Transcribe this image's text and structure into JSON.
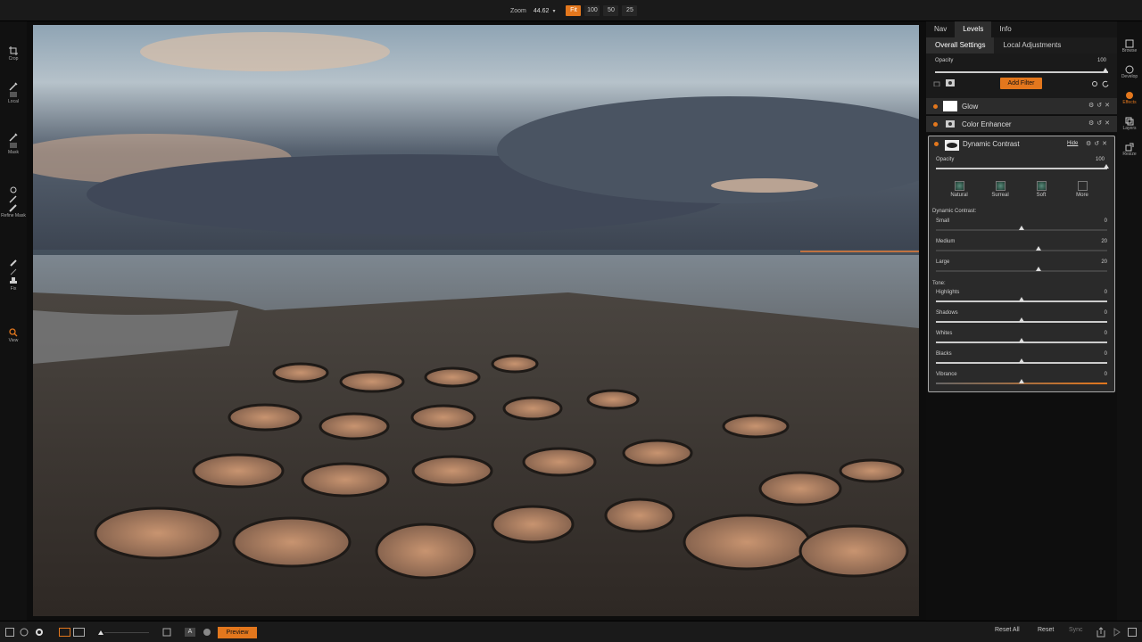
{
  "zoom": {
    "label": "Zoom",
    "value": "44.62",
    "buttons": [
      "Fit",
      "100",
      "50",
      "25"
    ],
    "active": "Fit"
  },
  "left_tools": [
    {
      "label": "Crop",
      "icon": "crop-icon"
    },
    {
      "label": "Local",
      "icon": "brush-icon"
    },
    {
      "label": "Mask",
      "icon": "mask-brush-icon"
    },
    {
      "label": "Refine Mask",
      "icon": "refine-brush-icon"
    },
    {
      "label": "Fix",
      "icon": "stamp-icon"
    },
    {
      "label": "View",
      "icon": "magnifier-icon"
    }
  ],
  "panel": {
    "tabs": [
      "Nav",
      "Levels",
      "Info"
    ],
    "active_tab": "Levels",
    "subtabs": [
      "Overall Settings",
      "Local Adjustments"
    ],
    "active_subtab": "Overall Settings",
    "opacity_label": "Opacity",
    "opacity_value": "100",
    "add_filter": "Add Filter",
    "filters": [
      {
        "name": "Glow"
      },
      {
        "name": "Color Enhancer"
      }
    ],
    "dynamic_contrast": {
      "name": "Dynamic Contrast",
      "hide": "Hide",
      "opacity_label": "Opacity",
      "opacity_value": "100",
      "presets": [
        "Natural",
        "Surreal",
        "Soft",
        "More"
      ],
      "section1": "Dynamic Contrast:",
      "sliders1": [
        {
          "label": "Small",
          "value": "0",
          "level": 0.5
        },
        {
          "label": "Medium",
          "value": "20",
          "level": 0.6
        },
        {
          "label": "Large",
          "value": "20",
          "level": 0.6
        }
      ],
      "section2": "Tone:",
      "sliders2": [
        {
          "label": "Highlights",
          "value": "0",
          "level": 0.5
        },
        {
          "label": "Shadows",
          "value": "0",
          "level": 0.5
        },
        {
          "label": "Whites",
          "value": "0",
          "level": 0.5
        },
        {
          "label": "Blacks",
          "value": "0",
          "level": 0.5
        },
        {
          "label": "Vibrance",
          "value": "0",
          "level": 0.5
        }
      ]
    }
  },
  "right_rail": [
    {
      "label": "Browse",
      "icon": "browse-icon"
    },
    {
      "label": "Develop",
      "icon": "develop-icon"
    },
    {
      "label": "Effects",
      "icon": "effects-icon",
      "active": true
    },
    {
      "label": "Layers",
      "icon": "layers-icon"
    },
    {
      "label": "Resize",
      "icon": "resize-icon"
    }
  ],
  "bottom": {
    "preview": "Preview",
    "reset_all": "Reset All",
    "reset": "Reset",
    "sync": "Sync",
    "mode_a": "A"
  },
  "colors": {
    "accent": "#e3771d",
    "panel": "#2a2a2a"
  }
}
